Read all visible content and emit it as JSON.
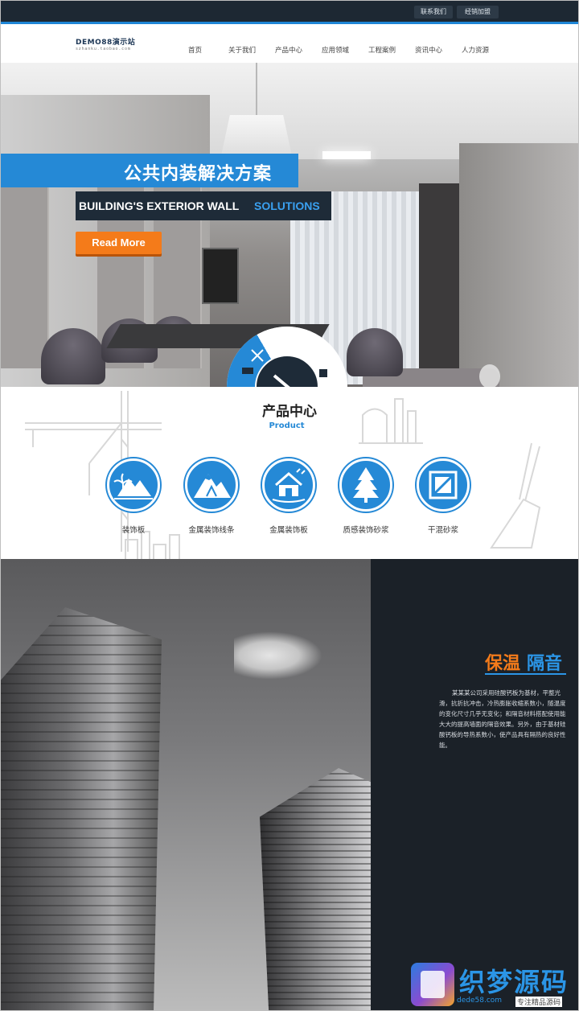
{
  "topbar": {
    "links": [
      "联系我们",
      "经销加盟"
    ]
  },
  "header": {
    "logo_main": "DEMO88演示站",
    "logo_sub": "szhanku.taobao.com",
    "nav": [
      "首页",
      "关于我们",
      "产品中心",
      "应用领域",
      "工程案例",
      "资讯中心",
      "人力资源"
    ]
  },
  "hero": {
    "title_cn": "公共内装解决方案",
    "subtitle_part1": "BUILDING'S EXTERIOR WALL",
    "subtitle_part2": "SOLUTIONS",
    "cta": "Read More"
  },
  "products": {
    "title": "产品中心",
    "subtitle": "Product",
    "items": [
      {
        "label": "装饰板",
        "icon": "mountain-palm-icon"
      },
      {
        "label": "金属装饰线条",
        "icon": "mountain-peak-icon"
      },
      {
        "label": "金属装饰板",
        "icon": "house-icon"
      },
      {
        "label": "质感装饰砂浆",
        "icon": "tree-icon"
      },
      {
        "label": "干混砂浆",
        "icon": "crate-icon"
      }
    ]
  },
  "insulation": {
    "title_part1": "保温",
    "title_part2": "隔音",
    "text": "某某某公司采用硅酸钙板为基材，平整光滑，抗折抗冲击，冷热膨胀收缩系数小，随温度的变化尺寸几乎无变化；和隔音材料搭配使用能大大的提高墙面的隔音效果。另外，由于基材硅酸钙板的导热系数小，使产品具有隔热的良好性能。"
  },
  "watermark": {
    "brand": "织梦源码",
    "url": "dede58.com",
    "tagline": "专注精品源码"
  },
  "colors": {
    "accent_blue": "#2589d6",
    "accent_orange": "#f47b1a",
    "dark_navy": "#1e2b38"
  }
}
